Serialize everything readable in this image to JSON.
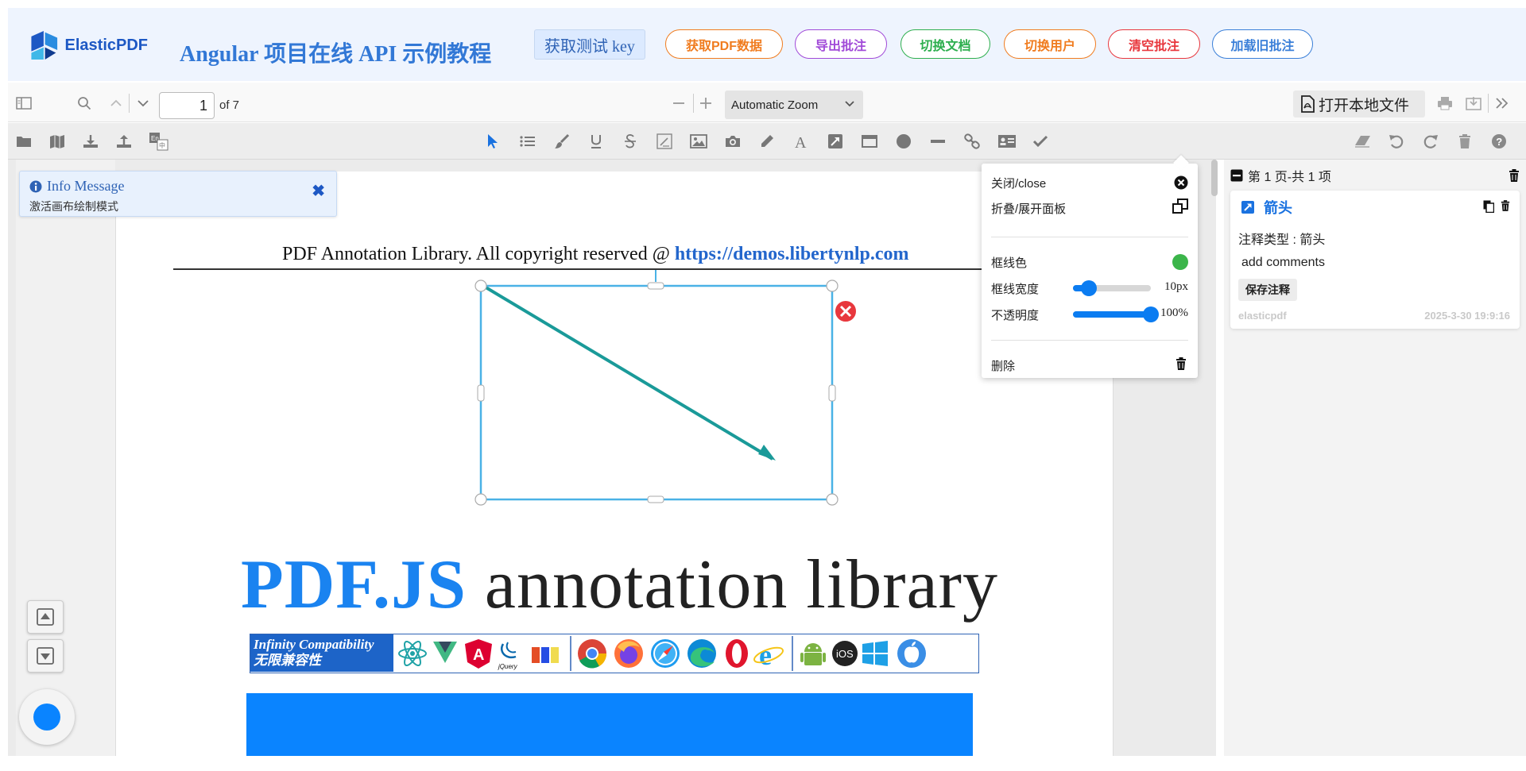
{
  "header": {
    "logo_text": "ElasticPDF",
    "title": "Angular 项目在线 API 示例教程",
    "key_button": "获取测试 key",
    "buttons": [
      {
        "label": "获取PDF数据",
        "color": "#f07c1f"
      },
      {
        "label": "导出批注",
        "color": "#a14ad8"
      },
      {
        "label": "切换文档",
        "color": "#2eaf4f"
      },
      {
        "label": "切换用户",
        "color": "#f07c1f"
      },
      {
        "label": "清空批注",
        "color": "#e8373d"
      },
      {
        "label": "加载旧批注",
        "color": "#3a7fd8"
      }
    ]
  },
  "toolbar": {
    "page_number": "1",
    "page_of": "of 7",
    "zoom": "Automatic Zoom",
    "open_local": "打开本地文件"
  },
  "info_message": {
    "title": "Info Message",
    "text": "激活画布绘制模式"
  },
  "pdf": {
    "header_text": "PDF Annotation Library. All copyright reserved @ ",
    "header_link": "https://demos.libertynlp.com",
    "big_title_blue": "PDF.JS",
    "big_title_black": " annotation library",
    "compat_label_en": "Infinity Compatibility",
    "compat_label_cn": "无限兼容性",
    "compat_icons": [
      "react-icon",
      "vue-icon",
      "angular-icon",
      "jquery-icon",
      "html-css-js-icon",
      "chrome-icon",
      "firefox-icon",
      "safari-icon",
      "edge-icon",
      "opera-icon",
      "ie-icon",
      "android-icon",
      "ios-icon",
      "windows-icon",
      "apple-icon"
    ],
    "ios_text": "iOS",
    "jquery_text": "jQuery"
  },
  "annotation": {
    "stroke_color": "#1a9a99",
    "selection_color": "#4ab2e6"
  },
  "property_popup": {
    "close_label": "关闭/close",
    "fold_label": "折叠/展开面板",
    "border_color_label": "框线色",
    "border_color": "#3bb54a",
    "border_width_label": "框线宽度",
    "border_width_value": "10px",
    "border_width_fraction": 0.2,
    "opacity_label": "不透明度",
    "opacity_value": "100%",
    "opacity_fraction": 1.0,
    "delete_label": "删除"
  },
  "side_panel": {
    "header": "第 1 页-共 1 项",
    "card": {
      "title": "箭头",
      "type_label": "注释类型 : 箭头",
      "comment": "add comments",
      "save_label": "保存注释",
      "user": "elasticpdf",
      "time": "2025-3-30 19:9:16"
    }
  }
}
